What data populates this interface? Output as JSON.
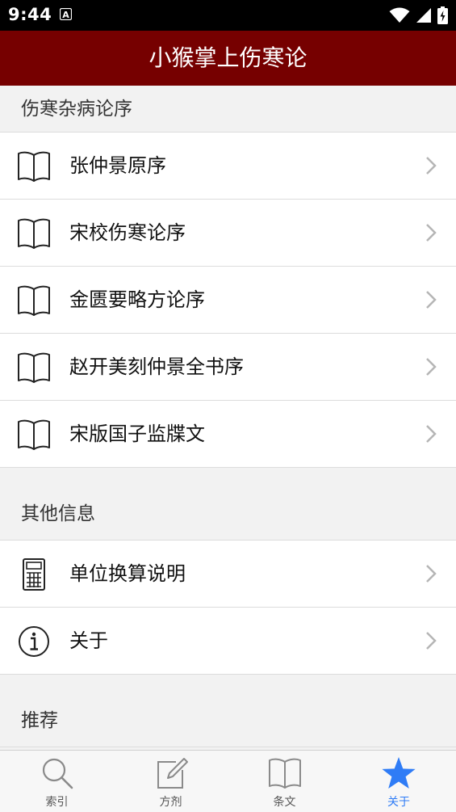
{
  "status_bar": {
    "time": "9:44",
    "notification_letter": "A"
  },
  "header": {
    "title": "小猴掌上伤寒论"
  },
  "sections": [
    {
      "header": "伤寒杂病论序",
      "items": [
        {
          "label": "张仲景原序",
          "icon": "book-icon"
        },
        {
          "label": "宋校伤寒论序",
          "icon": "book-icon"
        },
        {
          "label": "金匮要略方论序",
          "icon": "book-icon"
        },
        {
          "label": "赵开美刻仲景全书序",
          "icon": "book-icon"
        },
        {
          "label": "宋版国子监牒文",
          "icon": "book-icon"
        }
      ]
    },
    {
      "header": "其他信息",
      "items": [
        {
          "label": "单位换算说明",
          "icon": "calculator-icon"
        },
        {
          "label": "关于",
          "icon": "info-icon"
        }
      ]
    },
    {
      "header": "推荐"
    }
  ],
  "tab_bar": {
    "tabs": [
      {
        "label": "索引",
        "icon": "search-icon"
      },
      {
        "label": "方剂",
        "icon": "compose-icon"
      },
      {
        "label": "条文",
        "icon": "book-icon"
      },
      {
        "label": "关于",
        "icon": "star-icon",
        "active": true
      }
    ]
  },
  "colors": {
    "title_bar": "#760000",
    "active_tab": "#2f7cf6",
    "inactive_tab": "#555555",
    "section_background": "#f2f2f2"
  }
}
